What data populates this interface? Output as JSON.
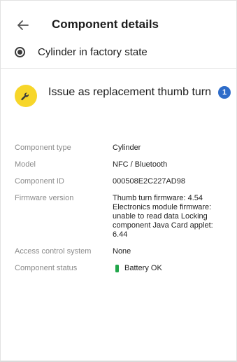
{
  "header": {
    "back_icon": "arrow-left-icon",
    "title": "Component details"
  },
  "state_option": {
    "label": "Cylinder in factory state",
    "selected": true
  },
  "action": {
    "icon": "wrench-icon",
    "icon_color": "#f7d62a",
    "label": "Issue as replacement thumb turn",
    "badge_count": "1",
    "badge_color": "#2e6cc9"
  },
  "details": {
    "component_type": {
      "label": "Component type",
      "value": "Cylinder"
    },
    "model": {
      "label": "Model",
      "value": "NFC / Bluetooth"
    },
    "component_id": {
      "label": "Component ID",
      "value": "000508E2C227AD98"
    },
    "firmware_version": {
      "label": "Firmware version",
      "value": "Thumb turn firmware: 4.54 Electronics module firmware: unable to read data Locking component Java Card applet: 6.44"
    },
    "access_control_system": {
      "label": "Access control system",
      "value": "None"
    },
    "component_status": {
      "label": "Component status",
      "value": "Battery OK",
      "status_color": "#22a64b"
    }
  }
}
